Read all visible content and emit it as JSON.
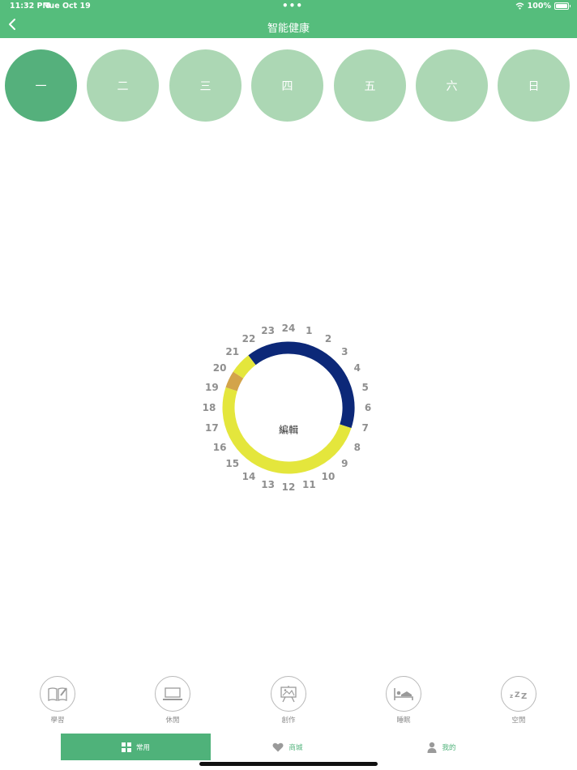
{
  "status_bar": {
    "time": "11:32 PM",
    "date": "Tue Oct 19",
    "dots": "•••",
    "battery": "100%"
  },
  "header": {
    "title": "智能健康",
    "back_icon": "chevron-left-icon"
  },
  "days": [
    "一",
    "二",
    "三",
    "四",
    "五",
    "六",
    "日"
  ],
  "selected_day": "一",
  "schedule": {
    "center_label": "編輯",
    "hours": [
      "24",
      "1",
      "2",
      "3",
      "4",
      "5",
      "6",
      "7",
      "8",
      "9",
      "10",
      "11",
      "12",
      "13",
      "14",
      "15",
      "16",
      "17",
      "18",
      "19",
      "20",
      "21",
      "22",
      "23"
    ],
    "segments": [
      {
        "activity": "睡眠",
        "start": 21.5,
        "end": 7.2,
        "color": "#0c2878"
      },
      {
        "activity": "休閒",
        "start": 7.2,
        "end": 19.2,
        "color": "#e4e63c"
      },
      {
        "activity": "創作",
        "start": 19.2,
        "end": 20.2,
        "color": "#d3a44a"
      },
      {
        "activity": "休閒",
        "start": 20.2,
        "end": 21.5,
        "color": "#e4e63c"
      }
    ]
  },
  "activities": [
    {
      "label": "學習",
      "icon": "book-icon"
    },
    {
      "label": "休閒",
      "icon": "laptop-icon"
    },
    {
      "label": "創作",
      "icon": "easel-icon"
    },
    {
      "label": "睡眠",
      "icon": "bed-icon"
    },
    {
      "label": "空閒",
      "icon": "zzz-icon"
    }
  ],
  "tabs": [
    {
      "label": "常用",
      "icon": "grid-icon",
      "active": true
    },
    {
      "label": "商城",
      "icon": "heart-icon",
      "active": false
    },
    {
      "label": "我的",
      "icon": "user-icon",
      "active": false
    }
  ],
  "colors": {
    "primary": "#55bd7c",
    "day_inactive": "#acd7b4",
    "day_active": "#55b07c"
  }
}
